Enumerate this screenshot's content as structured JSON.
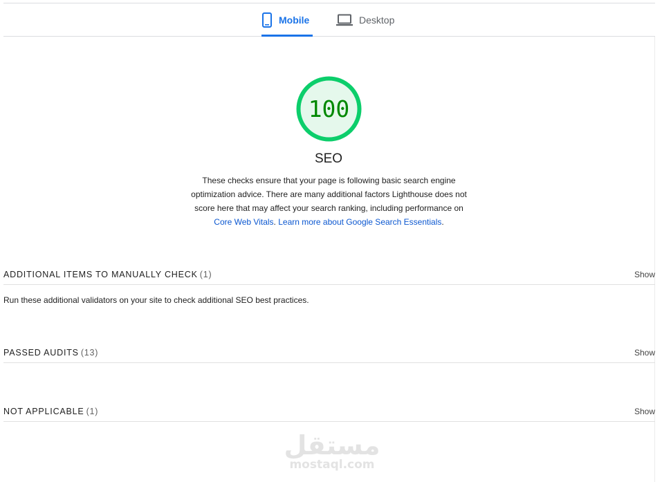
{
  "tabs": [
    {
      "label": "Mobile",
      "icon": "mobile-phone-icon",
      "active": true
    },
    {
      "label": "Desktop",
      "icon": "laptop-icon",
      "active": false
    }
  ],
  "score": {
    "value": "100",
    "fraction": 1.0,
    "color": "#0cce6b",
    "title": "SEO"
  },
  "description": {
    "text": "These checks ensure that your page is following basic search engine optimization advice. There are many additional factors Lighthouse does not score here that may affect your search ranking, including performance on",
    "link_core_web_vitals": "Core Web Vitals",
    "link_learn_more": "Learn more about Google Search Essentials"
  },
  "groups": [
    {
      "title": "ADDITIONAL ITEMS TO MANUALLY CHECK",
      "count": "(1)",
      "toggle": "Show",
      "description": "Run these additional validators on your site to check additional SEO best practices."
    },
    {
      "title": "PASSED AUDITS",
      "count": "(13)",
      "toggle": "Show"
    },
    {
      "title": "NOT APPLICABLE",
      "count": "(1)",
      "toggle": "Show"
    }
  ],
  "watermark": {
    "arabic": "مستقل",
    "domain": "mostaql.com"
  },
  "colors": {
    "accent": "#1a73e8",
    "pass_green": "#0cce6b",
    "pass_text": "#008800",
    "pass_fill": "#e5f8ec"
  }
}
